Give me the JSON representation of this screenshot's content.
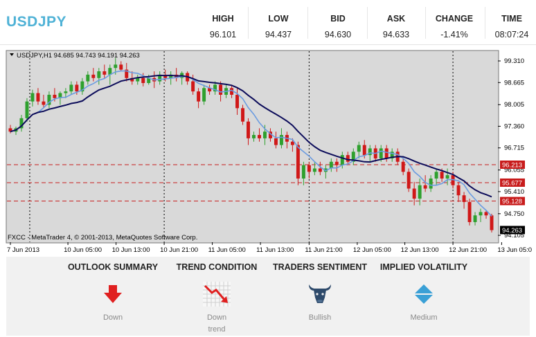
{
  "header": {
    "symbol": "USDJPY",
    "stats": [
      {
        "label": "HIGH",
        "value": "96.101"
      },
      {
        "label": "LOW",
        "value": "94.437"
      },
      {
        "label": "BID",
        "value": "94.630"
      },
      {
        "label": "ASK",
        "value": "94.633"
      },
      {
        "label": "CHANGE",
        "value": "-1.41%"
      },
      {
        "label": "TIME",
        "value": "08:07:24"
      }
    ]
  },
  "chart_data": {
    "type": "candlestick",
    "title": "USDJPY,H1  94.685 94.743 94.191 94.263",
    "copyright": "FXCC - MetaTrader 4, © 2001-2013, MetaQuotes Software Corp.",
    "y_ticks": [
      "99.310",
      "98.665",
      "98.005",
      "97.360",
      "96.715",
      "96.055",
      "95.410",
      "94.750",
      "94.105"
    ],
    "y_tick_values": [
      99.31,
      98.665,
      98.005,
      97.36,
      96.715,
      96.055,
      95.41,
      94.75,
      94.105
    ],
    "ylim": [
      93.9,
      99.6
    ],
    "x_ticks": [
      "7 Jun 2013",
      "10 Jun 05:00",
      "10 Jun 13:00",
      "10 Jun 21:00",
      "11 Jun 05:00",
      "11 Jun 13:00",
      "11 Jun 21:00",
      "12 Jun 05:00",
      "12 Jun 13:00",
      "12 Jun 21:00",
      "13 Jun 05:00"
    ],
    "x_tick_index": [
      0,
      10.4,
      19.1,
      27.8,
      36.5,
      45.2,
      54,
      62.7,
      71.3,
      80,
      88.8
    ],
    "day_separators": [
      3.5,
      27.8,
      54,
      80
    ],
    "levels": [
      {
        "value": 96.213,
        "label": "96.213"
      },
      {
        "value": 95.677,
        "label": "95.677"
      },
      {
        "value": 95.128,
        "label": "95.128"
      }
    ],
    "last_price": {
      "value": 94.263,
      "label": "94.263"
    },
    "colors": {
      "up": "#2ea02e",
      "down": "#d01818",
      "ma_fast": "#6a9be0",
      "ma_slow": "#0c0c5a",
      "levels": "#c81c1c",
      "background": "#d9d9d9"
    },
    "candles": [
      [
        97.3,
        97.4,
        97.15,
        97.2
      ],
      [
        97.2,
        97.35,
        97.1,
        97.3
      ],
      [
        97.3,
        97.7,
        97.2,
        97.6
      ],
      [
        97.6,
        98.2,
        97.5,
        98.1
      ],
      [
        98.1,
        98.45,
        97.95,
        98.35
      ],
      [
        98.35,
        98.5,
        98.0,
        98.1
      ],
      [
        98.1,
        98.3,
        97.9,
        98.0
      ],
      [
        98.0,
        98.4,
        97.9,
        98.3
      ],
      [
        98.3,
        98.5,
        98.1,
        98.2
      ],
      [
        98.2,
        98.4,
        98.0,
        98.35
      ],
      [
        98.35,
        98.5,
        98.2,
        98.4
      ],
      [
        98.4,
        98.7,
        98.3,
        98.6
      ],
      [
        98.6,
        98.7,
        98.3,
        98.4
      ],
      [
        98.4,
        98.8,
        98.3,
        98.7
      ],
      [
        98.7,
        99.0,
        98.6,
        98.9
      ],
      [
        98.9,
        99.1,
        98.7,
        98.8
      ],
      [
        98.8,
        99.1,
        98.6,
        99.0
      ],
      [
        99.0,
        99.2,
        98.8,
        98.9
      ],
      [
        98.9,
        99.2,
        98.6,
        99.1
      ],
      [
        99.1,
        99.4,
        98.9,
        99.2
      ],
      [
        99.2,
        99.3,
        99.0,
        99.05
      ],
      [
        99.05,
        99.25,
        98.7,
        98.8
      ],
      [
        98.8,
        99.0,
        98.6,
        98.7
      ],
      [
        98.7,
        98.9,
        98.6,
        98.8
      ],
      [
        98.8,
        98.95,
        98.55,
        98.65
      ],
      [
        98.65,
        98.9,
        98.6,
        98.8
      ],
      [
        98.8,
        99.0,
        98.5,
        98.7
      ],
      [
        98.7,
        99.0,
        98.6,
        98.9
      ],
      [
        98.9,
        99.05,
        98.7,
        98.8
      ],
      [
        98.8,
        99.0,
        98.6,
        98.9
      ],
      [
        98.9,
        99.1,
        98.7,
        98.8
      ],
      [
        98.8,
        99.0,
        98.6,
        98.95
      ],
      [
        98.95,
        99.0,
        98.6,
        98.7
      ],
      [
        98.7,
        98.9,
        98.3,
        98.4
      ],
      [
        98.4,
        98.5,
        97.9,
        98.1
      ],
      [
        98.1,
        98.6,
        98.0,
        98.5
      ],
      [
        98.5,
        98.6,
        98.3,
        98.4
      ],
      [
        98.4,
        98.7,
        98.3,
        98.6
      ],
      [
        98.6,
        98.7,
        98.1,
        98.3
      ],
      [
        98.3,
        98.6,
        98.2,
        98.5
      ],
      [
        98.5,
        98.6,
        98.2,
        98.3
      ],
      [
        98.3,
        98.5,
        97.7,
        97.9
      ],
      [
        97.9,
        98.0,
        97.4,
        97.5
      ],
      [
        97.5,
        97.6,
        96.8,
        97.0
      ],
      [
        97.0,
        97.2,
        96.9,
        97.1
      ],
      [
        97.1,
        97.3,
        96.9,
        97.0
      ],
      [
        97.0,
        97.4,
        96.8,
        97.2
      ],
      [
        97.2,
        97.3,
        96.9,
        97.0
      ],
      [
        97.0,
        97.2,
        96.7,
        96.8
      ],
      [
        96.8,
        97.3,
        96.7,
        97.1
      ],
      [
        97.1,
        97.2,
        96.7,
        96.9
      ],
      [
        96.9,
        97.0,
        96.6,
        96.8
      ],
      [
        96.8,
        96.9,
        95.6,
        95.8
      ],
      [
        95.8,
        96.3,
        95.6,
        96.2
      ],
      [
        96.2,
        96.3,
        95.8,
        96.0
      ],
      [
        96.0,
        96.3,
        95.9,
        96.1
      ],
      [
        96.1,
        96.3,
        95.9,
        96.0
      ],
      [
        96.0,
        96.2,
        95.8,
        96.1
      ],
      [
        96.1,
        96.4,
        96.0,
        96.3
      ],
      [
        96.3,
        96.4,
        96.0,
        96.2
      ],
      [
        96.2,
        96.6,
        96.1,
        96.5
      ],
      [
        96.5,
        96.6,
        96.2,
        96.3
      ],
      [
        96.3,
        96.7,
        96.2,
        96.6
      ],
      [
        96.6,
        96.9,
        96.4,
        96.8
      ],
      [
        96.8,
        96.95,
        96.4,
        96.5
      ],
      [
        96.5,
        96.8,
        96.3,
        96.7
      ],
      [
        96.7,
        96.8,
        96.3,
        96.4
      ],
      [
        96.4,
        96.8,
        96.3,
        96.7
      ],
      [
        96.7,
        96.8,
        96.3,
        96.4
      ],
      [
        96.4,
        96.7,
        96.3,
        96.6
      ],
      [
        96.6,
        96.7,
        96.2,
        96.3
      ],
      [
        96.3,
        96.4,
        95.9,
        96.0
      ],
      [
        96.0,
        96.1,
        95.4,
        95.5
      ],
      [
        95.5,
        95.7,
        95.0,
        95.2
      ],
      [
        95.2,
        95.8,
        95.0,
        95.6
      ],
      [
        95.6,
        95.9,
        95.4,
        95.5
      ],
      [
        95.5,
        95.9,
        95.4,
        95.8
      ],
      [
        95.8,
        96.1,
        95.6,
        96.0
      ],
      [
        96.0,
        96.1,
        95.7,
        95.8
      ],
      [
        95.8,
        96.1,
        95.6,
        95.9
      ],
      [
        95.9,
        96.0,
        95.5,
        95.6
      ],
      [
        95.6,
        95.7,
        95.1,
        95.3
      ],
      [
        95.3,
        95.4,
        94.9,
        95.1
      ],
      [
        95.1,
        95.2,
        94.4,
        94.5
      ],
      [
        94.5,
        94.8,
        94.4,
        94.7
      ],
      [
        94.7,
        94.9,
        94.5,
        94.8
      ],
      [
        94.8,
        94.85,
        94.6,
        94.7
      ],
      [
        94.7,
        94.75,
        94.19,
        94.26
      ]
    ]
  },
  "footer": {
    "sections": [
      {
        "title": "OUTLOOK SUMMARY",
        "caption": [
          "Down"
        ],
        "icon": "down-arrow-icon"
      },
      {
        "title": "TREND CONDITION",
        "caption": [
          "Down",
          "trend"
        ],
        "icon": "trend-down-chart-icon"
      },
      {
        "title": "TRADERS SENTIMENT",
        "caption": [
          "Bullish"
        ],
        "icon": "bull-head-icon"
      },
      {
        "title": "IMPLIED VOLATILITY",
        "caption": [
          "Medium"
        ],
        "icon": "diamond-icon"
      }
    ]
  }
}
